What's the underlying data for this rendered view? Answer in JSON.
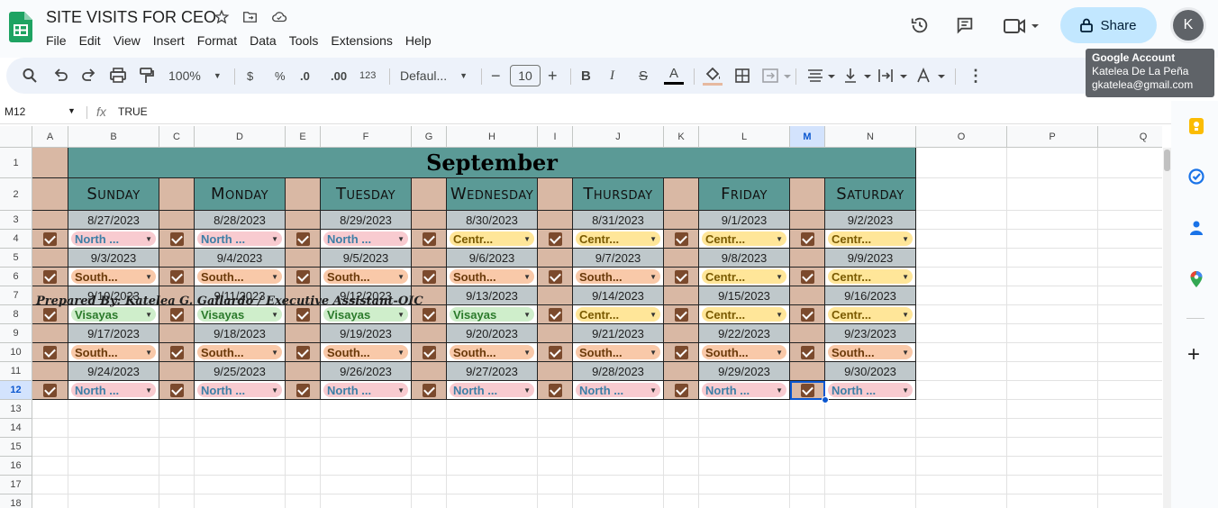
{
  "app": {
    "doc_title": "SITE VISITS FOR CEO",
    "menu": [
      "File",
      "Edit",
      "View",
      "Insert",
      "Format",
      "Data",
      "Tools",
      "Extensions",
      "Help"
    ],
    "share_label": "Share",
    "avatar_initial": "K"
  },
  "tooltip": {
    "title": "Google Account",
    "name": "Katelea De La Peña",
    "email": "gkatelea@gmail.com"
  },
  "toolbar": {
    "zoom": "100%",
    "currency": "$",
    "percent": "%",
    "dec_minus": ".0",
    "dec_plus": ".00",
    "format_123": "123",
    "font": "Defaul...",
    "font_size": "10",
    "bold": "B",
    "italic": "I",
    "strike": "S",
    "text_color": "A"
  },
  "formula_bar": {
    "cell_ref": "M12",
    "fx": "fx",
    "value": "TRUE"
  },
  "columns": [
    "A",
    "B",
    "C",
    "D",
    "E",
    "F",
    "G",
    "H",
    "I",
    "J",
    "K",
    "L",
    "M",
    "N",
    "O",
    "P",
    "Q"
  ],
  "rows": [
    "1",
    "2",
    "3",
    "4",
    "5",
    "6",
    "7",
    "8",
    "9",
    "10",
    "11",
    "12",
    "13",
    "14",
    "15",
    "16",
    "17",
    "18"
  ],
  "selected": {
    "col": "M",
    "row": "12"
  },
  "sheet": {
    "month": "September",
    "days": [
      "Sunday",
      "Monday",
      "Tuesday",
      "Wednesday",
      "Thursday",
      "Friday",
      "Saturday"
    ],
    "weeks": [
      {
        "dates": [
          "8/27/2023",
          "8/28/2023",
          "8/29/2023",
          "8/30/2023",
          "8/31/2023",
          "9/1/2023",
          "9/2/2023"
        ],
        "visits": [
          "North ...",
          "North ...",
          "North ...",
          "Centr...",
          "Centr...",
          "Centr...",
          "Centr..."
        ]
      },
      {
        "dates": [
          "9/3/2023",
          "9/4/2023",
          "9/5/2023",
          "9/6/2023",
          "9/7/2023",
          "9/8/2023",
          "9/9/2023"
        ],
        "visits": [
          "South...",
          "South...",
          "South...",
          "South...",
          "South...",
          "Centr...",
          "Centr..."
        ]
      },
      {
        "dates": [
          "9/10/2023",
          "9/11/2023",
          "9/12/2023",
          "9/13/2023",
          "9/14/2023",
          "9/15/2023",
          "9/16/2023"
        ],
        "visits": [
          "Visayas",
          "Visayas",
          "Visayas",
          "Visayas",
          "Centr...",
          "Centr...",
          "Centr..."
        ]
      },
      {
        "dates": [
          "9/17/2023",
          "9/18/2023",
          "9/19/2023",
          "9/20/2023",
          "9/21/2023",
          "9/22/2023",
          "9/23/2023"
        ],
        "visits": [
          "South...",
          "South...",
          "South...",
          "South...",
          "South...",
          "South...",
          "South..."
        ]
      },
      {
        "dates": [
          "9/24/2023",
          "9/25/2023",
          "9/26/2023",
          "9/27/2023",
          "9/28/2023",
          "9/29/2023",
          "9/30/2023"
        ],
        "visits": [
          "North ...",
          "North ...",
          "North ...",
          "North ...",
          "North ...",
          "North ...",
          "North ..."
        ]
      }
    ],
    "footer": "Prepared By: Katelea G. Gallardo / Executive Assistant-OIC"
  },
  "colors": {
    "header_teal": "#5b9a96",
    "tan": "#d9b8a4",
    "date_gray": "#bfc8cb",
    "checkbox": "#7b4a2d",
    "north": "#f8cbd0",
    "central": "#ffe699",
    "south": "#f9c9a9",
    "visayas": "#cfeecb",
    "north_text": "#3d7ea6",
    "central_text": "#7a5a00",
    "south_text": "#6b3a0a",
    "visayas_text": "#2b7a2b",
    "accent": "#0b57d0",
    "share_bg": "#c2e7ff"
  }
}
